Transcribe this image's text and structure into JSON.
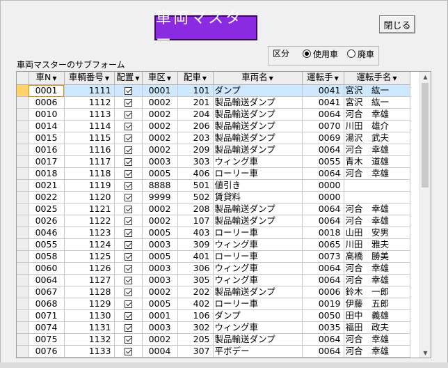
{
  "form": {
    "title": "車両マスター",
    "close_label": "閉じる",
    "kubun_label": "区分",
    "radio_active": "使用車",
    "radio_retired": "廃車",
    "subform_label": "車両マスターのサブフォーム"
  },
  "grid": {
    "headers": [
      "車N",
      "車輌番号",
      "配置",
      "車区",
      "配車",
      "車両名",
      "運転手",
      "運転手名"
    ],
    "rows": [
      {
        "no": "0001",
        "num": "1111",
        "c": "0001",
        "d": "101",
        "name": "ダンプ",
        "drv": "0041",
        "dn": "宮沢　紘一"
      },
      {
        "no": "0006",
        "num": "1112",
        "c": "0002",
        "d": "201",
        "name": "製品輸送ダンプ",
        "drv": "0041",
        "dn": "宮沢　紘一"
      },
      {
        "no": "0010",
        "num": "1113",
        "c": "0002",
        "d": "204",
        "name": "製品輸送ダンプ",
        "drv": "0064",
        "dn": "河合　幸雄"
      },
      {
        "no": "0014",
        "num": "1114",
        "c": "0002",
        "d": "206",
        "name": "製品輸送ダンプ",
        "drv": "0070",
        "dn": "川田　雄介"
      },
      {
        "no": "0015",
        "num": "1115",
        "c": "0002",
        "d": "203",
        "name": "製品輸送ダンプ",
        "drv": "0069",
        "dn": "湯沢　武夫"
      },
      {
        "no": "0016",
        "num": "1116",
        "c": "0002",
        "d": "209",
        "name": "製品輸送ダンプ",
        "drv": "0064",
        "dn": "河合　幸雄"
      },
      {
        "no": "0017",
        "num": "1117",
        "c": "0003",
        "d": "303",
        "name": "ウィング車",
        "drv": "0055",
        "dn": "青木　道雄"
      },
      {
        "no": "0018",
        "num": "1118",
        "c": "0005",
        "d": "406",
        "name": "ローリー車",
        "drv": "0064",
        "dn": "河合　幸雄"
      },
      {
        "no": "0021",
        "num": "1119",
        "c": "8888",
        "d": "501",
        "name": "値引き",
        "drv": "0000",
        "dn": ""
      },
      {
        "no": "0022",
        "num": "1120",
        "c": "9999",
        "d": "502",
        "name": "賃貸料",
        "drv": "0000",
        "dn": ""
      },
      {
        "no": "0025",
        "num": "1121",
        "c": "0002",
        "d": "208",
        "name": "製品輸送ダンプ",
        "drv": "0064",
        "dn": "河合　幸雄"
      },
      {
        "no": "0026",
        "num": "1122",
        "c": "0002",
        "d": "107",
        "name": "製品輸送ダンプ",
        "drv": "0064",
        "dn": "河合　幸雄"
      },
      {
        "no": "0046",
        "num": "1123",
        "c": "0005",
        "d": "403",
        "name": "ローリー車",
        "drv": "0018",
        "dn": "山田　安男"
      },
      {
        "no": "0055",
        "num": "1124",
        "c": "0003",
        "d": "309",
        "name": "ウィング車",
        "drv": "0065",
        "dn": "川田　雅夫"
      },
      {
        "no": "0058",
        "num": "1125",
        "c": "0005",
        "d": "401",
        "name": "ローリー車",
        "drv": "0073",
        "dn": "高橋　勝美"
      },
      {
        "no": "0060",
        "num": "1126",
        "c": "0003",
        "d": "306",
        "name": "ウィング車",
        "drv": "0064",
        "dn": "河合　幸雄"
      },
      {
        "no": "0064",
        "num": "1127",
        "c": "0003",
        "d": "305",
        "name": "ウィング車",
        "drv": "0064",
        "dn": "河合　幸雄"
      },
      {
        "no": "0067",
        "num": "1128",
        "c": "0002",
        "d": "202",
        "name": "製品輸送ダンプ",
        "drv": "0006",
        "dn": "鈴木　一郎"
      },
      {
        "no": "0068",
        "num": "1129",
        "c": "0005",
        "d": "402",
        "name": "ローリー車",
        "drv": "0019",
        "dn": "伊藤　五郎"
      },
      {
        "no": "0071",
        "num": "1130",
        "c": "0001",
        "d": "106",
        "name": "ダンプ",
        "drv": "0050",
        "dn": "田中　義雄"
      },
      {
        "no": "0074",
        "num": "1131",
        "c": "0003",
        "d": "302",
        "name": "ウィング車",
        "drv": "0035",
        "dn": "福田　政夫"
      },
      {
        "no": "0075",
        "num": "1132",
        "c": "0002",
        "d": "205",
        "name": "製品輸送ダンプ",
        "drv": "0064",
        "dn": "河合　幸雄"
      },
      {
        "no": "0076",
        "num": "1133",
        "c": "0004",
        "d": "307",
        "name": "平ボデー",
        "drv": "0064",
        "dn": "河合　幸雄"
      }
    ]
  },
  "colors": {
    "title_bg": "#8a2be2",
    "current_row": "#cde8ff",
    "selector_current": "#ffd36b"
  },
  "icons": {
    "dropdown": "dropdown-arrow-icon",
    "scroll_up": "scroll-up-icon",
    "scroll_down": "scroll-down-icon",
    "checkbox": "checkbox-checked-icon"
  }
}
